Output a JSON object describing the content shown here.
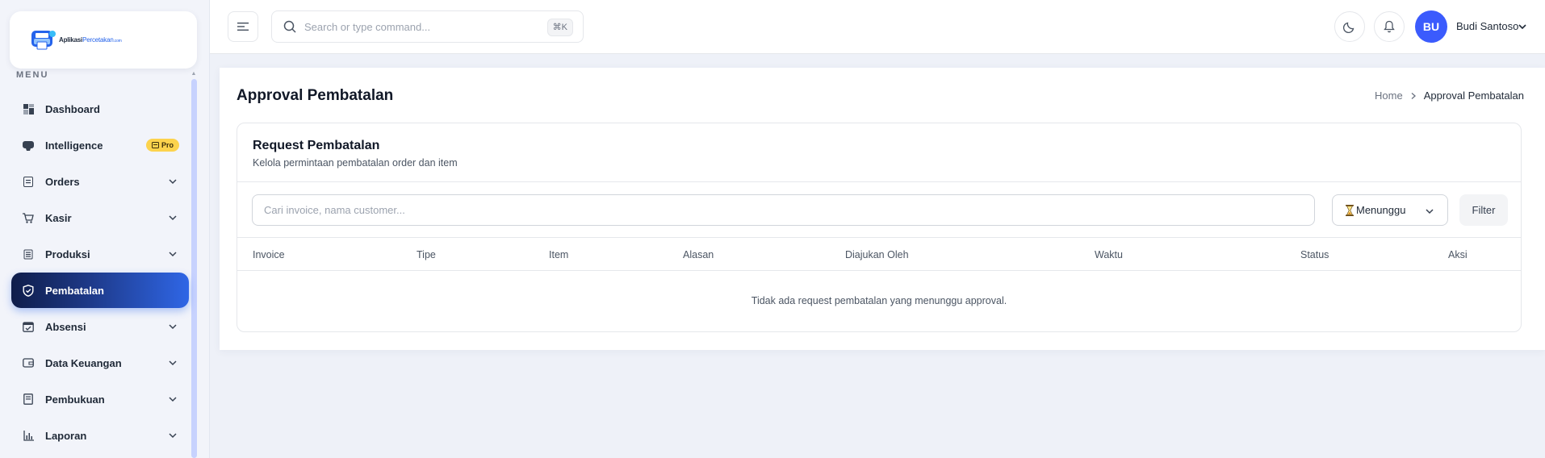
{
  "sidebar": {
    "logo": {
      "part1": "Aplikasi",
      "part2": "Percetakan",
      "part3": ".com"
    },
    "menu_label": "MENU",
    "items": [
      {
        "label": "Dashboard",
        "icon": "dashboard-icon"
      },
      {
        "label": "Intelligence",
        "icon": "brain-icon",
        "badge": "Pro"
      },
      {
        "label": "Orders",
        "icon": "orders-icon"
      },
      {
        "label": "Kasir",
        "icon": "cart-icon"
      },
      {
        "label": "Produksi",
        "icon": "produksi-icon"
      },
      {
        "label": "Pembatalan",
        "icon": "shield-check-icon",
        "active": true
      },
      {
        "label": "Absensi",
        "icon": "calendar-check-icon"
      },
      {
        "label": "Data Keuangan",
        "icon": "wallet-icon"
      },
      {
        "label": "Pembukuan",
        "icon": "book-icon"
      },
      {
        "label": "Laporan",
        "icon": "bar-chart-icon"
      }
    ]
  },
  "topbar": {
    "search_placeholder": "Search or type command...",
    "shortcut": "⌘K",
    "user": {
      "initials": "BU",
      "name": "Budi Santoso"
    }
  },
  "page": {
    "title": "Approval Pembatalan",
    "breadcrumb": {
      "home": "Home",
      "current": "Approval Pembatalan"
    }
  },
  "card": {
    "title": "Request Pembatalan",
    "subtitle": "Kelola permintaan pembatalan order dan item",
    "search_placeholder": "Cari invoice, nama customer...",
    "status_filter": "Menunggu",
    "filter_button": "Filter",
    "columns": [
      "Invoice",
      "Tipe",
      "Item",
      "Alasan",
      "Diajukan Oleh",
      "Waktu",
      "Status",
      "Aksi"
    ],
    "empty_message": "Tidak ada request pembatalan yang menunggu approval."
  },
  "colors": {
    "accent": "#2563eb",
    "active_nav_dark": "#0f1d4a",
    "avatar": "#3b5bfd",
    "pro_badge": "#fcd34d"
  }
}
